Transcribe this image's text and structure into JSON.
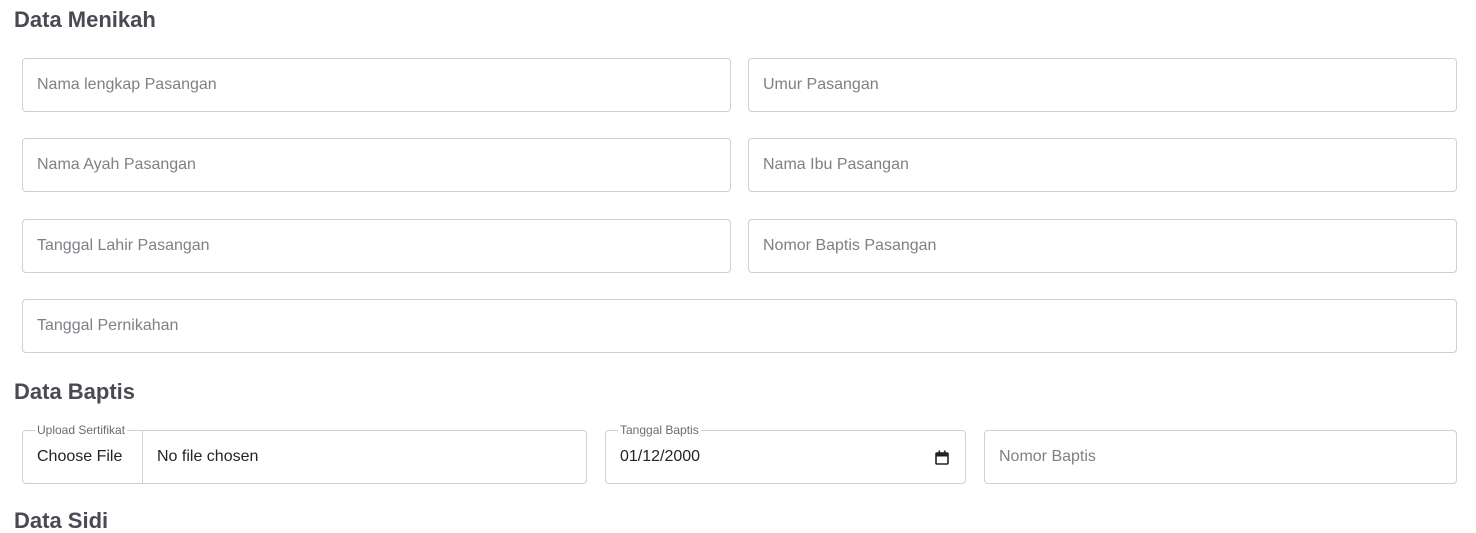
{
  "sections": {
    "menikah": {
      "title": "Data Menikah",
      "fields": {
        "nama_lengkap_pasangan": "Nama lengkap Pasangan",
        "umur_pasangan": "Umur Pasangan",
        "nama_ayah_pasangan": "Nama Ayah Pasangan",
        "nama_ibu_pasangan": "Nama Ibu Pasangan",
        "tanggal_lahir_pasangan": "Tanggal Lahir Pasangan",
        "nomor_baptis_pasangan": "Nomor Baptis Pasangan",
        "tanggal_pernikahan": "Tanggal Pernikahan"
      }
    },
    "baptis": {
      "title": "Data Baptis",
      "upload": {
        "label": "Upload Sertifikat",
        "button": "Choose File",
        "status": "No file chosen"
      },
      "tanggal": {
        "label": "Tanggal Baptis",
        "value": "01/12/2000",
        "icon": "calendar-icon"
      },
      "nomor_baptis": "Nomor Baptis"
    },
    "next": {
      "title": "Data Sidi"
    }
  }
}
